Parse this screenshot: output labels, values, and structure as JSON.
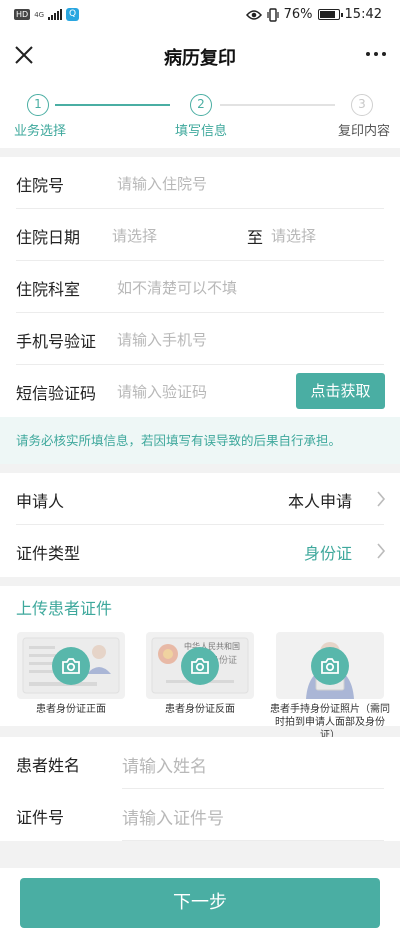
{
  "status_bar": {
    "hd": "HD",
    "network": "4G",
    "battery": "76%",
    "time": "15:42"
  },
  "header": {
    "title": "病历复印"
  },
  "steps": [
    {
      "num": "1",
      "label": "业务选择"
    },
    {
      "num": "2",
      "label": "填写信息"
    },
    {
      "num": "3",
      "label": "复印内容"
    }
  ],
  "form": {
    "admission_no": {
      "label": "住院号",
      "placeholder": "请输入住院号"
    },
    "admission_date": {
      "label": "住院日期",
      "start_placeholder": "请选择",
      "to": "至",
      "end_placeholder": "请选择"
    },
    "department": {
      "label": "住院科室",
      "placeholder": "如不清楚可以不填"
    },
    "phone": {
      "label": "手机号验证",
      "placeholder": "请输入手机号"
    },
    "sms_code": {
      "label": "短信验证码",
      "placeholder": "请输入验证码",
      "button": "点击获取"
    }
  },
  "notice": "请务必核实所填信息，若因填写有误导致的后果自行承担。",
  "applicant": {
    "applicant": {
      "label": "申请人",
      "value": "本人申请"
    },
    "id_type": {
      "label": "证件类型",
      "value": "身份证"
    }
  },
  "upload": {
    "title": "上传患者证件",
    "cards": [
      {
        "caption": "患者身份证正面"
      },
      {
        "caption": "患者身份证反面",
        "card_text_1": "中华人民共和国",
        "card_text_2": "居民身份证"
      },
      {
        "caption": "患者手持身份证照片（需同时拍到申请人面部及身份证）"
      }
    ]
  },
  "patient": {
    "name": {
      "label": "患者姓名",
      "placeholder": "请输入姓名"
    },
    "id_no": {
      "label": "证件号",
      "placeholder": "请输入证件号"
    }
  },
  "footer": {
    "next": "下一步"
  },
  "colors": {
    "accent": "#4aaea3",
    "notice_bg": "#eef7f6"
  }
}
